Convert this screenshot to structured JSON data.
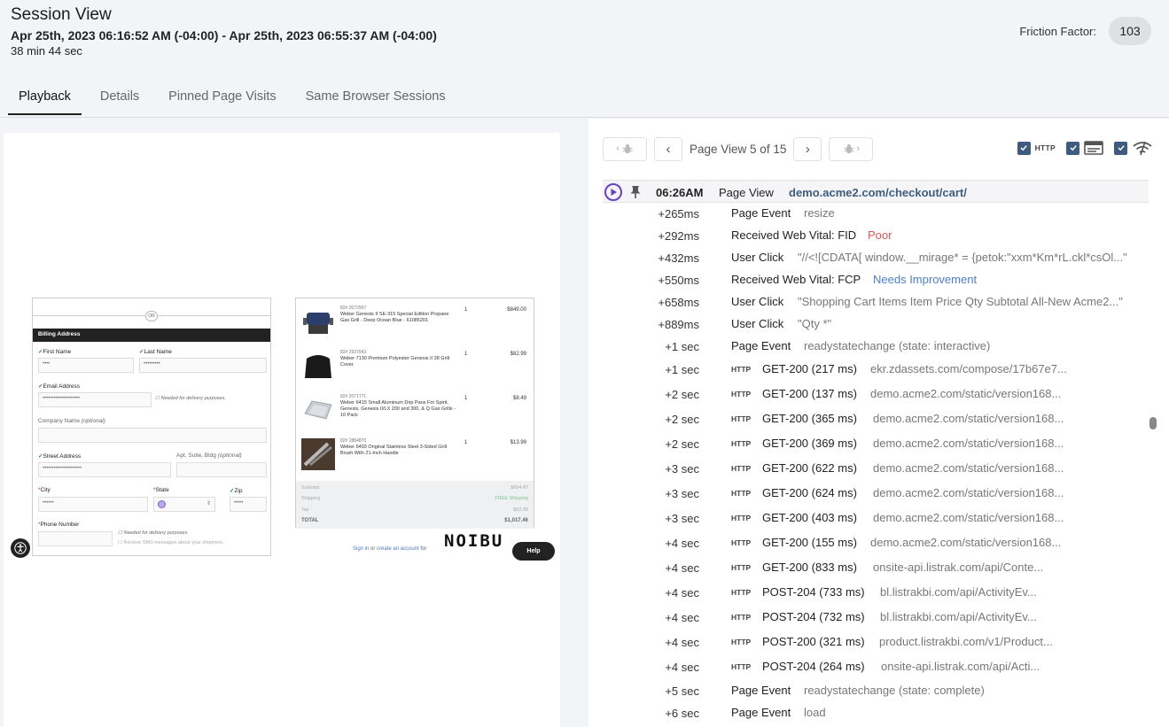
{
  "header": {
    "title": "Session View",
    "time_range": "Apr 25th, 2023 06:16:52 AM (-04:00) - Apr 25th, 2023 06:55:37 AM (-04:00)",
    "duration": "38 min 44 sec",
    "friction_label": "Friction Factor:",
    "friction_value": "103"
  },
  "tabs": [
    {
      "label": "Playback",
      "active": true
    },
    {
      "label": "Details",
      "active": false
    },
    {
      "label": "Pinned Page Visits",
      "active": false
    },
    {
      "label": "Same Browser Sessions",
      "active": false
    }
  ],
  "playback": {
    "or_label": "OR",
    "billing_title": "Billing Address",
    "first_name_label": "First Name",
    "first_name_value": "••••",
    "last_name_label": "Last Name",
    "last_name_value": "•••••••••",
    "email_label": "Email Address",
    "email_value": "••••••••••••••••••••",
    "email_hint": "Needed for delivery purposes.",
    "company_label": "Company Name",
    "company_optional": "(optional)",
    "street_label": "Street Address",
    "street_value": "•••••••••••••••••••••",
    "apt_label": "Apt, Suite, Bldg",
    "apt_optional": "(optional)",
    "city_label": "City",
    "city_value": "••••••",
    "state_label": "State",
    "zip_label": "Zip",
    "zip_value": "•••••",
    "phone_label": "Phone Number",
    "phone_hint": "Needed for delivery purposes.",
    "sms_hint": "Receive SMS messages about your shipment.",
    "cart_items": [
      {
        "sku": "82# 3072907",
        "name": "Weber Genesis II SE-315 Special Edition Propane Gas Grill - Deep Ocean Blue - 61085201",
        "qty": "1",
        "price": "$849.00"
      },
      {
        "sku": "82# 2937943",
        "name": "Weber 7130 Premium Polyester Genesis II 38 Grill Cover",
        "qty": "1",
        "price": "$82.99"
      },
      {
        "sku": "82# 2071771",
        "name": "Weber 6415 Small Aluminum Drip Pans For Spirit, Genesis, Genesis II/LX 200 and 300, & Q Gas Grills - 10 Pack",
        "qty": "1",
        "price": "$8.49"
      },
      {
        "sku": "82# 2884870",
        "name": "Weber 6493 Original Stainless Steel 3-Sided Grill Brush With 21-Inch Handle",
        "qty": "1",
        "price": "$13.99"
      }
    ],
    "totals": [
      {
        "label": "Subtotal",
        "value": "$954.47"
      },
      {
        "label": "Shipping",
        "value": "FREE Shipping"
      },
      {
        "label": "Tax",
        "value": "$62.99"
      },
      {
        "label": "TOTAL",
        "value": "$1,017.46"
      }
    ],
    "signin_link": "Sign in",
    "signin_mid": "or",
    "create_link": "create an account",
    "signin_tail": "for",
    "logo_text": "NOIBU",
    "help_label": "Help"
  },
  "pager": {
    "label": "Page View 5 of 15"
  },
  "filters": {
    "http_label": "HTTP",
    "accent_color": "#3e5c80"
  },
  "page_view": {
    "time": "06:26AM",
    "kind": "Page View",
    "url": "demo.acme2.com/checkout/cart/"
  },
  "events": [
    {
      "time": "+265ms",
      "label": "Page Event",
      "detail": "resize"
    },
    {
      "time": "+292ms",
      "label": "Received Web Vital: FID",
      "detail": "Poor"
    },
    {
      "time": "+432ms",
      "label": "User Click",
      "detail": "\"//<![CDATA[ window.__mirage* = {petok:\"xxm*Km*rL.ckl*csOl...\""
    },
    {
      "time": "+550ms",
      "label": "Received Web Vital: FCP",
      "detail": "Needs Improvement"
    },
    {
      "time": "+658ms",
      "label": "User Click",
      "detail": "\"Shopping Cart Items Item Price Qty Subtotal All-New Acme2...\""
    },
    {
      "time": "+889ms",
      "label": "User Click",
      "detail": "\"Qty *\""
    },
    {
      "time": "+1 sec",
      "label": "Page Event",
      "detail": "readystatechange (state: interactive)"
    }
  ],
  "http_events": [
    {
      "time": "+1 sec",
      "tag": "HTTP",
      "status": "GET-200 (217 ms)",
      "url": "ekr.zdassets.com/compose/17b67e7..."
    },
    {
      "time": "+2 sec",
      "tag": "HTTP",
      "status": "GET-200 (137 ms)",
      "url": "demo.acme2.com/static/version168..."
    },
    {
      "time": "+2 sec",
      "tag": "HTTP",
      "status": "GET-200 (365 ms)",
      "url": "demo.acme2.com/static/version168..."
    },
    {
      "time": "+2 sec",
      "tag": "HTTP",
      "status": "GET-200 (369 ms)",
      "url": "demo.acme2.com/static/version168..."
    },
    {
      "time": "+3 sec",
      "tag": "HTTP",
      "status": "GET-200 (622 ms)",
      "url": "demo.acme2.com/static/version168..."
    },
    {
      "time": "+3 sec",
      "tag": "HTTP",
      "status": "GET-200 (624 ms)",
      "url": "demo.acme2.com/static/version168..."
    },
    {
      "time": "+3 sec",
      "tag": "HTTP",
      "status": "GET-200 (403 ms)",
      "url": "demo.acme2.com/static/version168..."
    },
    {
      "time": "+4 sec",
      "tag": "HTTP",
      "status": "GET-200 (155 ms)",
      "url": "demo.acme2.com/static/version168..."
    },
    {
      "time": "+4 sec",
      "tag": "HTTP",
      "status": "GET-200 (833 ms)",
      "url": "onsite-api.listrak.com/api/Conte..."
    },
    {
      "time": "+4 sec",
      "tag": "HTTP",
      "status": "POST-204 (733 ms)",
      "url": "bl.listrakbi.com/api/ActivityEv..."
    },
    {
      "time": "+4 sec",
      "tag": "HTTP",
      "status": "POST-204 (732 ms)",
      "url": "bl.listrakbi.com/api/ActivityEv..."
    },
    {
      "time": "+4 sec",
      "tag": "HTTP",
      "status": "POST-200 (321 ms)",
      "url": "product.listrakbi.com/v1/Product..."
    },
    {
      "time": "+4 sec",
      "tag": "HTTP",
      "status": "POST-204 (264 ms)",
      "url": "onsite-api.listrak.com/api/Acti..."
    }
  ],
  "tail_events": [
    {
      "time": "+5 sec",
      "label": "Page Event",
      "detail": "readystatechange (state: complete)"
    },
    {
      "time": "+6 sec",
      "label": "Page Event",
      "detail": "load"
    }
  ]
}
